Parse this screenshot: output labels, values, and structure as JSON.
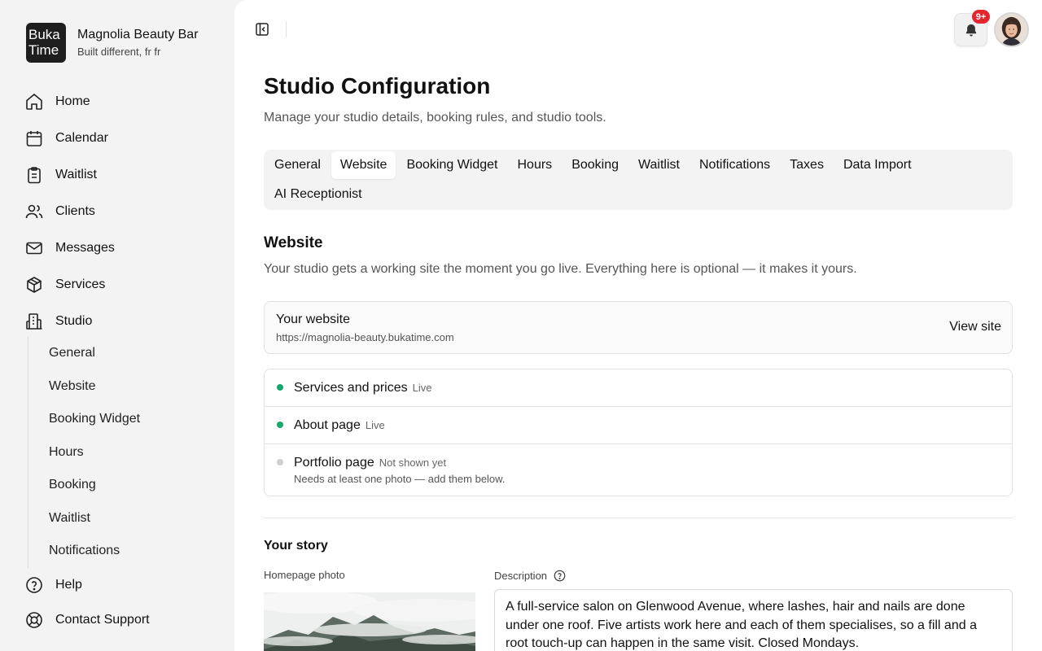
{
  "brand": {
    "logo_line1": "Buka",
    "logo_line2": "Time",
    "name": "Magnolia Beauty Bar",
    "tagline": "Built different, fr fr"
  },
  "nav": {
    "items": [
      {
        "label": "Home",
        "icon": "home-icon"
      },
      {
        "label": "Calendar",
        "icon": "calendar-icon"
      },
      {
        "label": "Waitlist",
        "icon": "clipboard-icon"
      },
      {
        "label": "Clients",
        "icon": "users-icon"
      },
      {
        "label": "Messages",
        "icon": "mail-icon"
      },
      {
        "label": "Services",
        "icon": "box-icon"
      },
      {
        "label": "Studio",
        "icon": "building-icon"
      }
    ],
    "studio_sub": [
      "General",
      "Website",
      "Booking Widget",
      "Hours",
      "Booking",
      "Waitlist",
      "Notifications"
    ],
    "bottom": [
      {
        "label": "Help",
        "icon": "help-circle-icon"
      },
      {
        "label": "Contact Support",
        "icon": "lifebuoy-icon"
      }
    ]
  },
  "topbar": {
    "notification_badge": "9+"
  },
  "page": {
    "title": "Studio Configuration",
    "subtitle": "Manage your studio details, booking rules, and studio tools.",
    "tabs": [
      "General",
      "Website",
      "Booking Widget",
      "Hours",
      "Booking",
      "Waitlist",
      "Notifications",
      "Taxes",
      "Data Import",
      "AI Receptionist"
    ],
    "active_tab": "Website"
  },
  "website": {
    "title": "Website",
    "subtitle": "Your studio gets a working site the moment you go live. Everything here is optional — it makes it yours.",
    "site_label": "Your website",
    "site_url": "https://magnolia-beauty.bukatime.com",
    "view_site": "View site",
    "status": [
      {
        "name": "Services and prices",
        "tag": "Live",
        "color": "#16a86b",
        "note": ""
      },
      {
        "name": "About page",
        "tag": "Live",
        "color": "#16a86b",
        "note": ""
      },
      {
        "name": "Portfolio page",
        "tag": "Not shown yet",
        "color": "#cfcfcf",
        "note": "Needs at least one photo — add them below."
      }
    ]
  },
  "story": {
    "title": "Your story",
    "photo_label": "Homepage photo",
    "description_label": "Description",
    "description": "A full-service salon on Glenwood Avenue, where lashes, hair and nails are done under one roof. Five artists work here and each of them specialises, so a fill and a root touch-up can happen in the same visit. Closed Mondays."
  }
}
